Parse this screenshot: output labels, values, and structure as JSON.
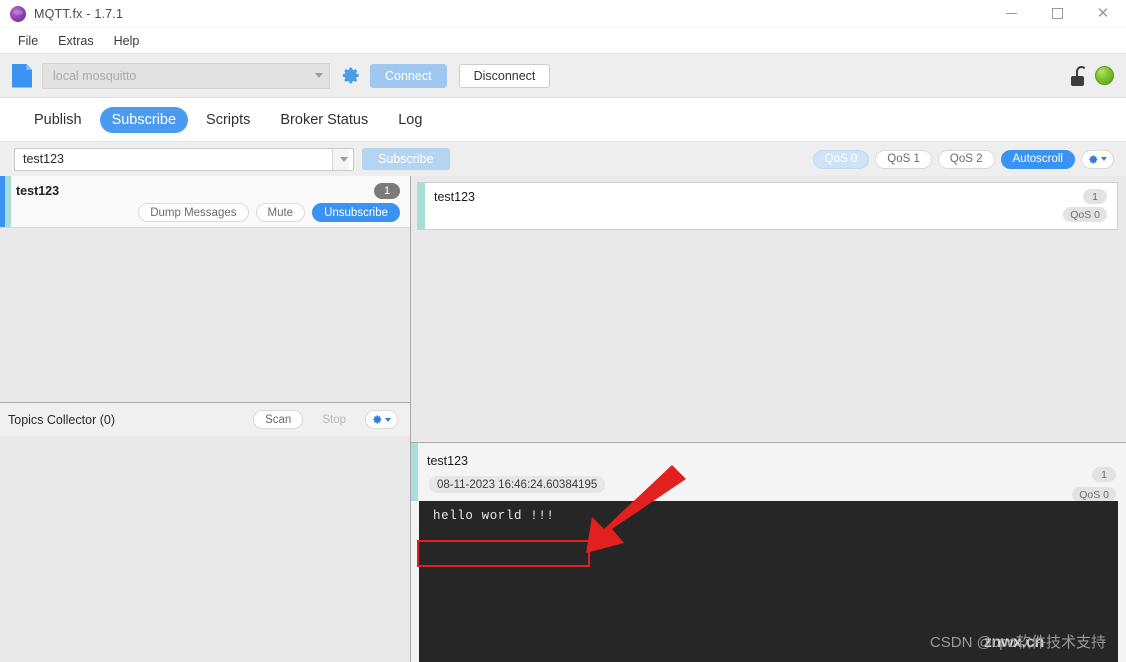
{
  "window": {
    "title": "MQTT.fx - 1.7.1",
    "app_icon": "mqttfx-logo-icon",
    "controls": {
      "minimize": "minimize-icon",
      "maximize": "maximize-icon",
      "close": "close-icon"
    }
  },
  "menu": {
    "items": [
      "File",
      "Extras",
      "Help"
    ]
  },
  "toolbar": {
    "file_icon": "document-icon",
    "broker": {
      "value": "local mosquitto",
      "placeholder": "local mosquitto"
    },
    "settings_icon": "gear-icon",
    "connect_label": "Connect",
    "disconnect_label": "Disconnect",
    "lock_icon": "unlocked-padlock-icon",
    "status_icon": "green-status-dot",
    "status_color": "#7cc22c",
    "connect_color": "#9fc7ef"
  },
  "tabs": {
    "items": [
      "Publish",
      "Subscribe",
      "Scripts",
      "Broker Status",
      "Log"
    ],
    "active": "Subscribe",
    "active_color": "#4a9bf0"
  },
  "subscribe_bar": {
    "topic_value": "test123",
    "subscribe_label": "Subscribe",
    "qos_options": [
      "QoS 0",
      "QoS 1",
      "QoS 2"
    ],
    "qos_selected": "QoS 0",
    "autoscroll_label": "Autoscroll",
    "options_icon": "gear-dropdown-icon"
  },
  "subscriptions": [
    {
      "topic": "test123",
      "count": "1",
      "dump_label": "Dump Messages",
      "mute_label": "Mute",
      "unsubscribe_label": "Unsubscribe"
    }
  ],
  "topics_collector": {
    "title": "Topics Collector (0)",
    "scan_label": "Scan",
    "stop_label": "Stop",
    "options_icon": "gear-dropdown-icon"
  },
  "messages": [
    {
      "topic": "test123",
      "count": "1",
      "qos": "QoS 0"
    }
  ],
  "message_detail": {
    "topic": "test123",
    "timestamp": "08-11-2023 16:46:24.60384195",
    "count": "1",
    "qos": "QoS 0",
    "payload": "hello world !!!"
  },
  "watermarks": {
    "csdn": "CSDN @cpo软件技术支持",
    "brand": "znwx.cn"
  },
  "annotations": {
    "highlight_color": "#e02020",
    "arrow_color": "#e32020"
  }
}
